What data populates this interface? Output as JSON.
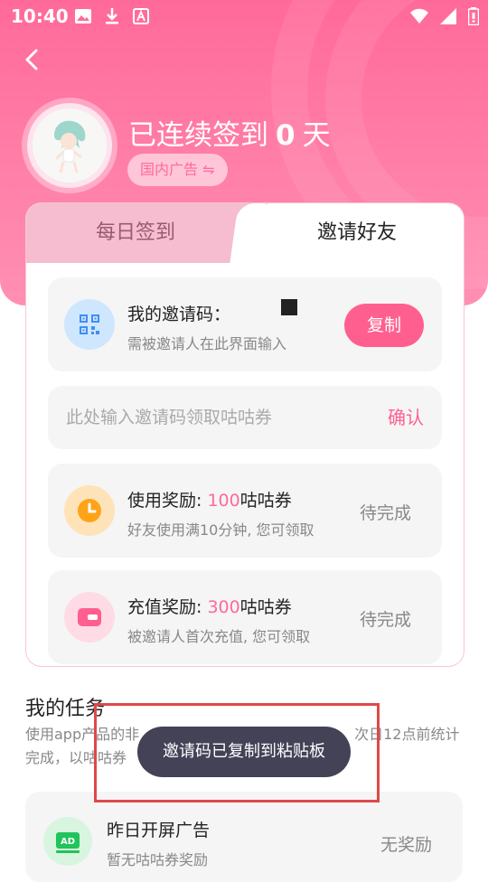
{
  "status_bar": {
    "time": "10:40",
    "left_icons": [
      "image-icon",
      "download-icon",
      "font-icon"
    ],
    "right_icons": [
      "wifi-icon",
      "signal-icon",
      "battery-icon"
    ]
  },
  "header": {
    "streak_prefix": "已连续签到",
    "streak_days": "0",
    "streak_suffix": "天",
    "ad_chip": "国内广告 ⇋",
    "accent_color": "#ff6a9a"
  },
  "tabs": [
    {
      "label": "每日签到",
      "active": false
    },
    {
      "label": "邀请好友",
      "active": true
    }
  ],
  "invite": {
    "code_label": "我的邀请码：",
    "code_hint": "需被邀请人在此界面输入",
    "copy_label": "复制",
    "input_placeholder": "此处输入邀请码领取咕咕券",
    "confirm_label": "确认"
  },
  "rewards": [
    {
      "title_prefix": "使用奖励: ",
      "amount": "100",
      "title_suffix": "咕咕券",
      "desc": "好友使用满10分钟, 您可领取",
      "status": "待完成",
      "icon": "clock-icon"
    },
    {
      "title_prefix": "充值奖励: ",
      "amount": "300",
      "title_suffix": "咕咕券",
      "desc": "被邀请人首次充值, 您可领取",
      "status": "待完成",
      "icon": "wallet-icon"
    }
  ],
  "tasks": {
    "title": "我的任务",
    "desc_line1_start": "使用app产品的非",
    "desc_line1_end": "次日12点前统计",
    "desc_line2": "完成，以咕咕券",
    "items": [
      {
        "title": "昨日开屏广告",
        "subtitle": "暂无咕咕券奖励",
        "reward": "无奖励",
        "icon": "ad-icon",
        "icon_text": "AD"
      }
    ]
  },
  "toast": "邀请码已复制到粘贴板"
}
